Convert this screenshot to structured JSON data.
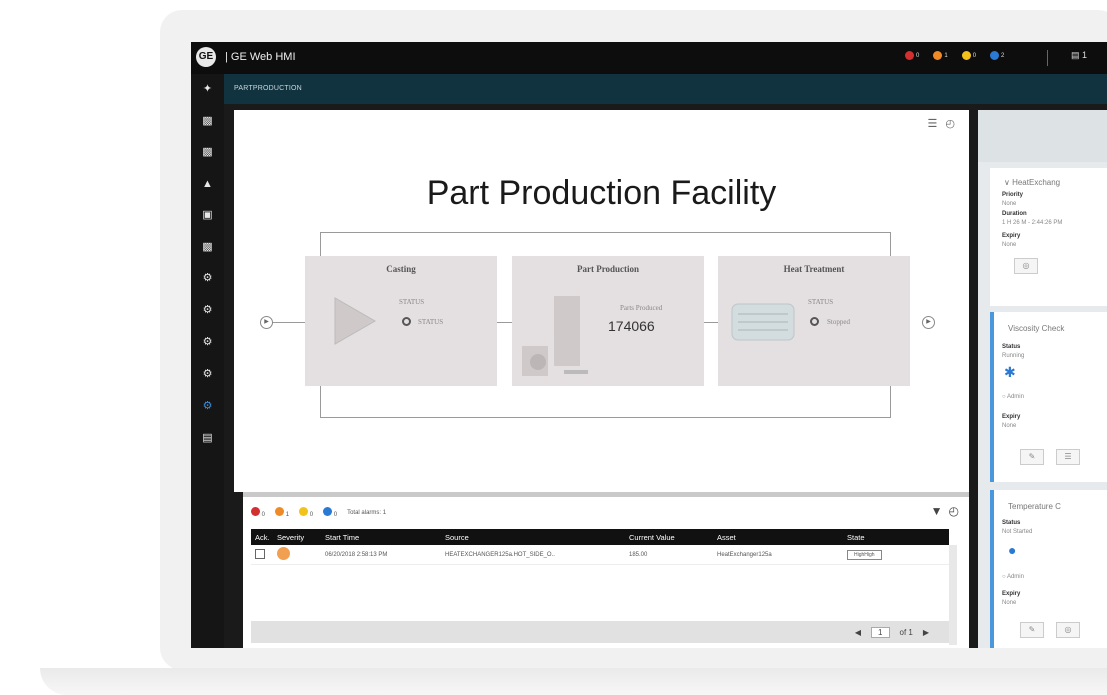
{
  "app": {
    "logo": "GE",
    "title": "| GE Web HMI"
  },
  "top_alarms": [
    {
      "color": "#d32f2f",
      "count": "0"
    },
    {
      "color": "#f08a24",
      "count": "1"
    },
    {
      "color": "#f3c21a",
      "count": "0"
    },
    {
      "color": "#2a79d4",
      "count": "2"
    }
  ],
  "top_right": {
    "icon": "document-icon",
    "count": "1"
  },
  "sidebar_icons": [
    "network-icon",
    "screens-icon",
    "screens-alt-icon",
    "alarm-icon",
    "trend-icon",
    "reports-icon",
    "gear-icon",
    "gear-icon",
    "gear-icon",
    "gear-icon",
    "gear-active-icon",
    "clipboard-icon"
  ],
  "breadcrumb": "PARTPRODUCTION",
  "facility": {
    "title": "Part Production Facility",
    "stations": [
      {
        "name": "Casting",
        "status_label": "STATUS",
        "status_value": "STATUS"
      },
      {
        "name": "Part Production",
        "counter_label": "Parts Produced",
        "counter_value": "174066"
      },
      {
        "name": "Heat Treatment",
        "status_label": "STATUS",
        "status_value": "Stopped"
      }
    ]
  },
  "alarm_summary": {
    "counts": [
      {
        "color": "#d32f2f",
        "count": "0"
      },
      {
        "color": "#f08a24",
        "count": "1"
      },
      {
        "color": "#f3c21a",
        "count": "0"
      },
      {
        "color": "#2a79d4",
        "count": "0"
      }
    ],
    "total": "Total alarms: 1"
  },
  "alarm_table": {
    "columns": [
      "Ack.",
      "Severity",
      "Start Time",
      "Source",
      "Current Value",
      "Asset",
      "State"
    ],
    "rows": [
      {
        "start": "06/20/2018 2:58:13 PM",
        "source": "HEATEXCHANGER125a.HOT_SIDE_O..",
        "value": "185.00",
        "asset": "HeatExchanger125a",
        "state": "HighHigh"
      }
    ],
    "pager": {
      "page": "1",
      "of": "of 1"
    }
  },
  "right_panel": {
    "card1": {
      "title": "HeatExchang",
      "priority_label": "Priority",
      "priority": "None",
      "duration_label": "Duration",
      "duration": "1 H 26 M - 2:44:26 PM",
      "expiry_label": "Expiry",
      "expiry": "None"
    },
    "card2": {
      "title": "Viscosity Check",
      "status_label": "Status",
      "status": "Running",
      "user": "Admin",
      "expiry_label": "Expiry",
      "expiry": "None"
    },
    "card3": {
      "title": "Temperature C",
      "status_label": "Status",
      "status": "Not Started",
      "user": "Admin",
      "expiry_label": "Expiry",
      "expiry": "None"
    }
  }
}
